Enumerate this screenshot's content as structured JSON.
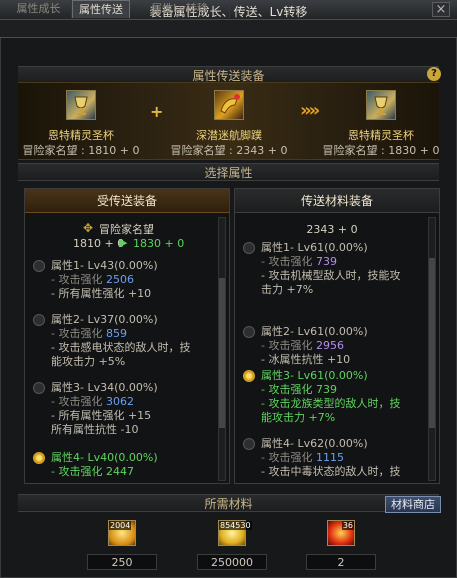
{
  "window": {
    "title": "装备属性成长、传送、Lv转移",
    "close_glyph": "×"
  },
  "tabs": [
    {
      "label": "属性成长",
      "active": false
    },
    {
      "label": "属性传送",
      "active": true
    },
    {
      "label": "属性Lv转移",
      "active": false
    }
  ],
  "transfer_section": {
    "title": "属性传送装备",
    "help_glyph": "?",
    "source_item": {
      "name": "恩特精灵圣杯",
      "fame": "冒险家名望 : 1810 + 0"
    },
    "material_item": {
      "name": "深潜迷航脚蹼",
      "fame": "冒险家名望 : 2343 + 0"
    },
    "result_item": {
      "name": "恩特精灵圣杯",
      "fame": "冒险家名望 : 1830 + 0"
    },
    "plus_glyph": "+",
    "arrow_glyph": "»»"
  },
  "select_section": {
    "title": "选择属性"
  },
  "left_panel": {
    "title": "受传送装备",
    "fame_label": "冒险家名望",
    "fame_before": "1810 + 0",
    "fame_after": "1830 + 0",
    "properties": [
      {
        "name": "属性1- Lv43(0.00%)",
        "selected": false,
        "lines": [
          {
            "text": "- 攻击强化 ",
            "value": "2506",
            "color": "blue"
          },
          {
            "text": "- 所有属性强化 +10",
            "value": "",
            "color": "gray"
          }
        ]
      },
      {
        "name": "属性2- Lv37(0.00%)",
        "selected": false,
        "lines": [
          {
            "text": "- 攻击强化 ",
            "value": "859",
            "color": "blue"
          },
          {
            "text": "- 攻击感电状态的敌人时，技",
            "value": "",
            "color": "gray"
          },
          {
            "text": "  能攻击力 +5%",
            "value": "",
            "color": "gray"
          }
        ]
      },
      {
        "name": "属性3- Lv34(0.00%)",
        "selected": false,
        "lines": [
          {
            "text": "- 攻击强化 ",
            "value": "3062",
            "color": "blue"
          },
          {
            "text": "- 所有属性强化 +15",
            "value": "",
            "color": "gray"
          },
          {
            "text": "  所有属性抗性 -10",
            "value": "",
            "color": "gray"
          }
        ]
      },
      {
        "name": "属性4- Lv40(0.00%)",
        "selected": true,
        "lines": [
          {
            "text": "- 攻击强化 ",
            "value": "2447",
            "color": "green"
          }
        ]
      }
    ]
  },
  "right_panel": {
    "title": "传送材料装备",
    "fame": "2343 + 0",
    "properties": [
      {
        "name": "属性1- Lv61(0.00%)",
        "selected": false,
        "lines": [
          {
            "text": "- 攻击强化 ",
            "value": "739",
            "color": "purple"
          },
          {
            "text": "- 攻击机械型敌人时，技能攻",
            "value": "",
            "color": "gray"
          },
          {
            "text": "  击力 +7%",
            "value": "",
            "color": "gray"
          }
        ]
      },
      {
        "name": "属性2- Lv61(0.00%)",
        "selected": false,
        "lines": [
          {
            "text": "- 攻击强化 ",
            "value": "2956",
            "color": "purple"
          },
          {
            "text": "- 冰属性抗性 +10",
            "value": "",
            "color": "gray"
          }
        ]
      },
      {
        "name": "属性3- Lv61(0.00%)",
        "selected": true,
        "lines": [
          {
            "text": "- 攻击强化 ",
            "value": "739",
            "color": "green"
          },
          {
            "text": "- 攻击龙族类型的敌人时，技",
            "value": "",
            "color": "green"
          },
          {
            "text": "  能攻击力 +7%",
            "value": "",
            "color": "green"
          }
        ]
      },
      {
        "name": "属性4- Lv62(0.00%)",
        "selected": false,
        "lines": [
          {
            "text": "- 攻击强化 ",
            "value": "1115",
            "color": "blue"
          },
          {
            "text": "- 攻击中毒状态的敌人时，技",
            "value": "",
            "color": "gray"
          }
        ]
      }
    ]
  },
  "materials_section": {
    "title": "所需材料",
    "shop_button": "材料商店",
    "items": [
      {
        "badge": "2004",
        "value": "250",
        "icon": "gold-crystal-icon"
      },
      {
        "badge": "854530",
        "value": "250000",
        "icon": "gold-coins-icon"
      },
      {
        "badge": "36",
        "value": "2",
        "icon": "fire-gem-icon"
      }
    ]
  }
}
